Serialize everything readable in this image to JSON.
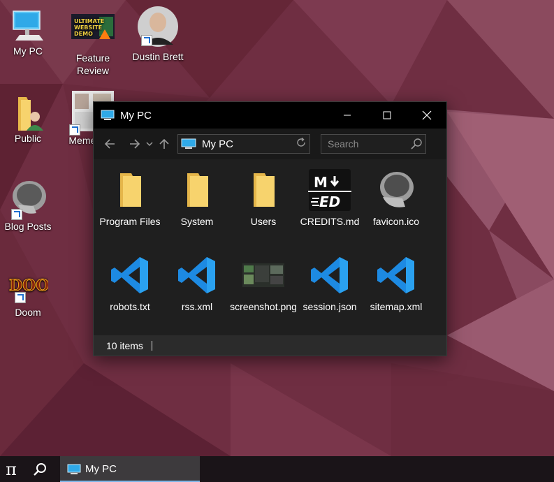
{
  "desktop": {
    "icons": [
      {
        "label": "My PC"
      },
      {
        "label": "Feature Review",
        "thumb_text": "ULTIMATE WEBSITE DEMO"
      },
      {
        "label": "Dustin Brett"
      },
      {
        "label": "Public"
      },
      {
        "label": "Memes Mo"
      },
      {
        "label": "Blog Posts"
      },
      {
        "label": "Doom",
        "logo_text": "DOOM"
      }
    ]
  },
  "window": {
    "title": "My PC",
    "address": "My PC",
    "search_placeholder": "Search",
    "files": [
      {
        "label": "Program Files",
        "icon": "folder-icon"
      },
      {
        "label": "System",
        "icon": "folder-icon"
      },
      {
        "label": "Users",
        "icon": "folder-icon"
      },
      {
        "label": "CREDITS.md",
        "icon": "markdown-icon"
      },
      {
        "label": "favicon.ico",
        "icon": "brain-scan-icon"
      },
      {
        "label": "robots.txt",
        "icon": "vscode-icon"
      },
      {
        "label": "rss.xml",
        "icon": "vscode-icon"
      },
      {
        "label": "screenshot.png",
        "icon": "screenshot-thumbnail"
      },
      {
        "label": "session.json",
        "icon": "vscode-icon"
      },
      {
        "label": "sitemap.xml",
        "icon": "vscode-icon"
      }
    ],
    "status": "10 items"
  },
  "taskbar": {
    "start_glyph": "π",
    "task_label": "My PC"
  },
  "colors": {
    "wallpaper": "#6e2d40",
    "window_bg": "#1f1f1f",
    "titlebar": "#000000",
    "vscode_blue": "#1d8ae2",
    "folder_yellow": "#f5cf61",
    "taskbar": "#1a1418"
  }
}
